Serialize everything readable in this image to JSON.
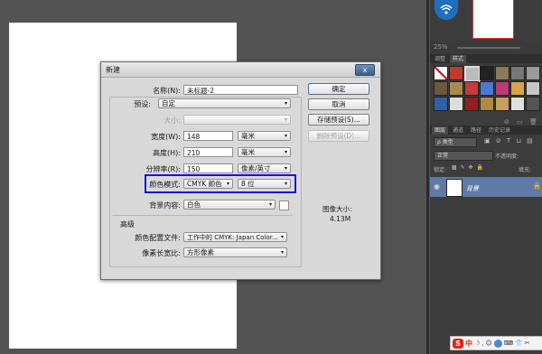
{
  "right_panel": {
    "zoom": "25%",
    "swatch_tabs": [
      "调整",
      "样式"
    ],
    "layers_tabs": [
      "图层",
      "通道",
      "路径",
      "历史记录"
    ],
    "kind_filter": "ρ 类型",
    "blend_mode": "正常",
    "opacity_label": "不透明度:",
    "lock_label": "锁定:",
    "fill_label": "填充:",
    "layer_name": "背景",
    "ime_char": "中"
  },
  "dialog": {
    "title": "新建",
    "close": "x",
    "name_label": "名称(N):",
    "name_value": "未标题-2",
    "preset_label": "预设:",
    "preset_value": "自定",
    "size_label": "大小:",
    "width_label": "宽度(W):",
    "width_value": "148",
    "width_unit": "毫米",
    "height_label": "高度(H):",
    "height_value": "210",
    "height_unit": "毫米",
    "resolution_label": "分辨率(R):",
    "resolution_value": "150",
    "resolution_unit": "像素/英寸",
    "color_mode_label": "颜色模式:",
    "color_mode_value": "CMYK 颜色",
    "bit_depth_value": "8 位",
    "background_label": "背景内容:",
    "background_value": "白色",
    "advanced_label": "高级",
    "color_profile_label": "颜色配置文件:",
    "color_profile_value": "工作中的 CMYK: Japan Color...",
    "pixel_aspect_label": "像素长宽比:",
    "pixel_aspect_value": "方形像素",
    "ok_button": "确定",
    "cancel_button": "取消",
    "save_preset_button": "存储预设(S)...",
    "delete_preset_button": "删除预设(D)...",
    "image_size_label": "图像大小:",
    "image_size_value": "4.13M"
  },
  "colors": {
    "highlight": "#1515d8",
    "workspace": "#535353",
    "layer_selected": "#5e7ba6"
  }
}
